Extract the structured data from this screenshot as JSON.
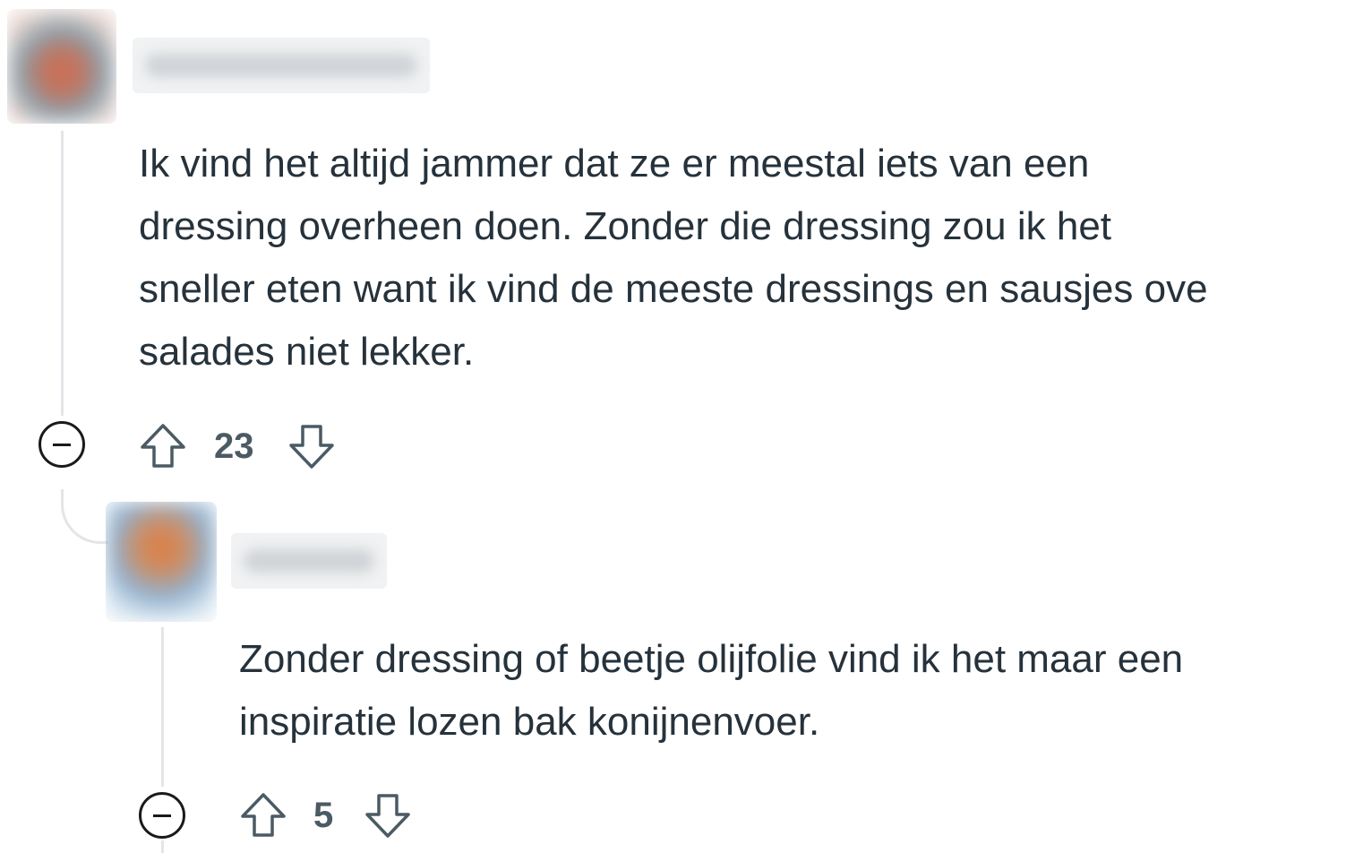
{
  "comments": [
    {
      "avatar_colors": [
        "#d66a4a",
        "#8ba1ad",
        "#e9d6cf"
      ],
      "username": "",
      "text": "Ik vind het altijd jammer dat ze er meestal iets van een\ndressing overheen doen. Zonder die dressing zou ik het\nsneller eten want ik vind de meeste dressings en sausjes ove\nsalades niet lekker.",
      "votes": "23",
      "icons": {
        "collapse": "collapse-minus-icon",
        "upvote": "upvote-arrow-icon",
        "downvote": "downvote-arrow-icon"
      }
    },
    {
      "avatar_colors": [
        "#e07b3c",
        "#8fb0cf",
        "#d8e6f0"
      ],
      "username": "",
      "text": "Zonder dressing of beetje olijfolie vind ik het maar een\ninspiratie lozen bak konijnenvoer.",
      "votes": "5",
      "icons": {
        "collapse": "collapse-minus-icon",
        "upvote": "upvote-arrow-icon",
        "downvote": "downvote-arrow-icon"
      }
    }
  ]
}
